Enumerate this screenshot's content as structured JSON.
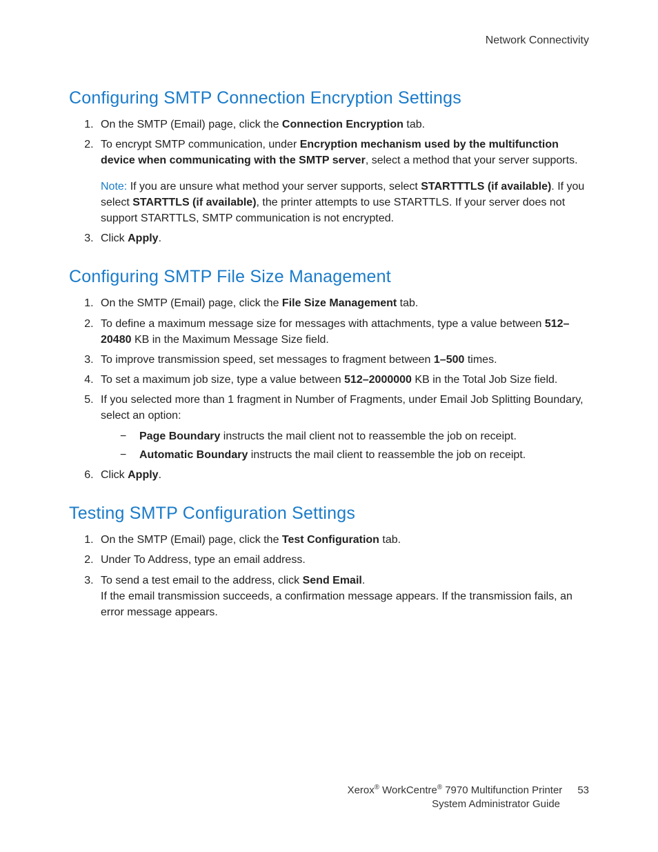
{
  "header": {
    "right": "Network Connectivity"
  },
  "section1": {
    "title": "Configuring SMTP Connection Encryption Settings",
    "items": {
      "i1": {
        "pre": "On the SMTP (Email) page, click the ",
        "b1": "Connection Encryption",
        "post": " tab."
      },
      "i2": {
        "pre": "To encrypt SMTP communication, under ",
        "b1": "Encryption mechanism used by the multifunction device when communicating with the SMTP server",
        "post": ", select a method that your server supports."
      },
      "note": {
        "label": "Note:",
        "pre": " If you are unsure what method your server supports, select ",
        "b1": "STARTTTLS (if available)",
        "mid": ". If you select ",
        "b2": "STARTTLS (if available)",
        "post": ", the printer attempts to use STARTTLS. If your server does not support STARTTLS, SMTP communication is not encrypted."
      },
      "i3": {
        "pre": "Click ",
        "b1": "Apply",
        "post": "."
      }
    }
  },
  "section2": {
    "title": "Configuring SMTP File Size Management",
    "items": {
      "i1": {
        "pre": "On the SMTP (Email) page, click the ",
        "b1": "File Size Management",
        "post": " tab."
      },
      "i2": {
        "pre": "To define a maximum message size for messages with attachments, type a value between ",
        "b1": "512–20480",
        "post": " KB in the Maximum Message Size field."
      },
      "i3": {
        "pre": "To improve transmission speed, set messages to fragment between ",
        "b1": "1–500",
        "post": " times."
      },
      "i4": {
        "pre": "To set a maximum job size, type a value between ",
        "b1": "512–2000000",
        "post": " KB in the Total Job Size field."
      },
      "i5": {
        "text": "If you selected more than 1 fragment in Number of Fragments, under Email Job Splitting Boundary, select an option:"
      },
      "sub": {
        "a": {
          "b": "Page Boundary",
          "post": " instructs the mail client not to reassemble the job on receipt."
        },
        "b": {
          "b": "Automatic Boundary",
          "post": " instructs the mail client to reassemble the job on receipt."
        }
      },
      "i6": {
        "pre": "Click ",
        "b1": "Apply",
        "post": "."
      }
    }
  },
  "section3": {
    "title": "Testing SMTP Configuration Settings",
    "items": {
      "i1": {
        "pre": "On the SMTP (Email) page, click the ",
        "b1": "Test Configuration",
        "post": " tab."
      },
      "i2": {
        "text": "Under To Address, type an email address."
      },
      "i3": {
        "pre": "To send a test email to the address, click ",
        "b1": "Send Email",
        "post": "."
      },
      "i3b": {
        "text": "If the email transmission succeeds, a confirmation message appears. If the transmission fails, an error message appears."
      }
    }
  },
  "footer": {
    "brand1": "Xerox",
    "brand2": " WorkCentre",
    "product": " 7970 Multifunction Printer",
    "line2": "System Administrator Guide",
    "page": "53",
    "reg": "®"
  }
}
